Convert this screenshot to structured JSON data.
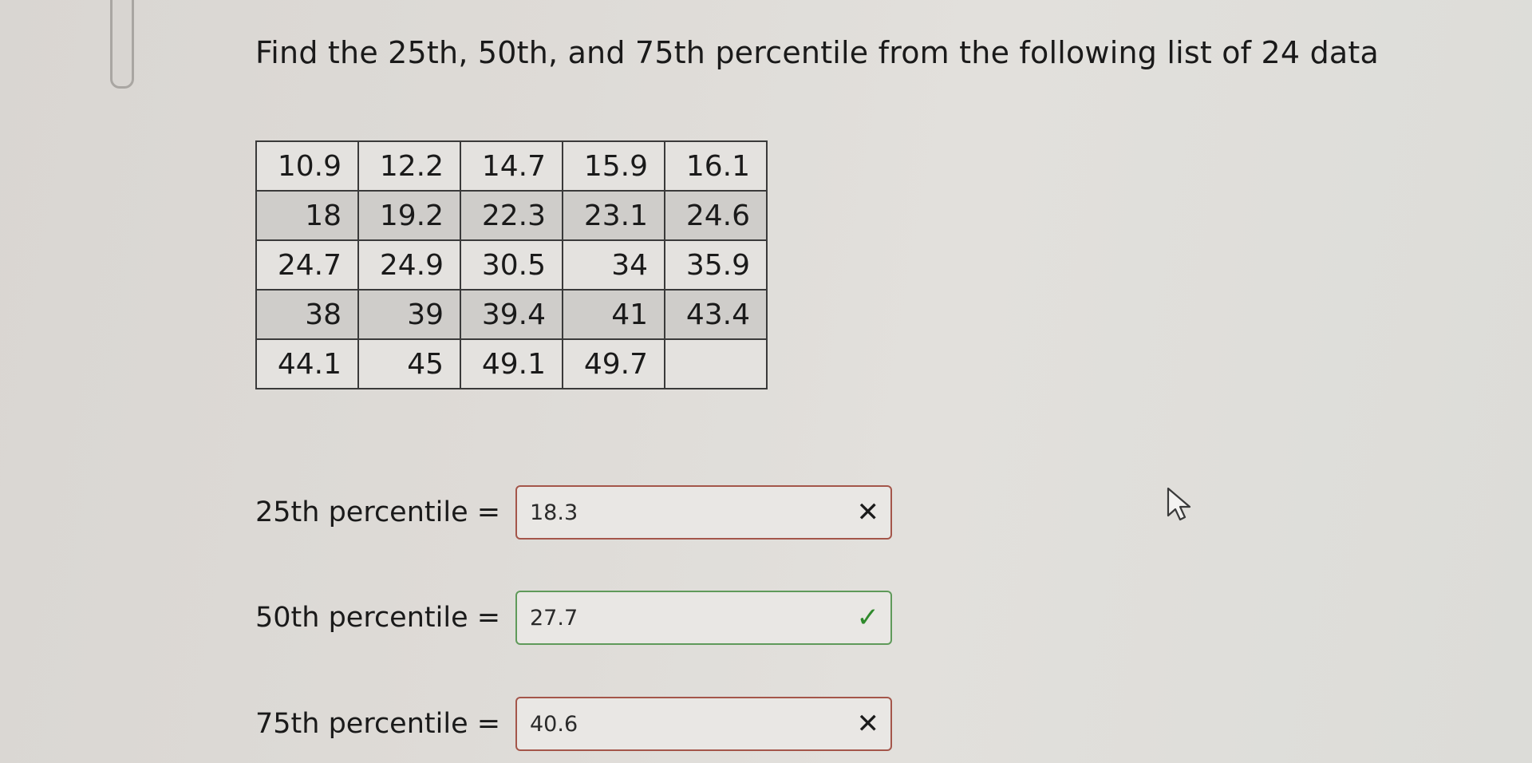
{
  "question": {
    "text": "Find the 25th, 50th, and 75th percentile from the following list of 24 data"
  },
  "data_table": {
    "rows": [
      [
        "10.9",
        "12.2",
        "14.7",
        "15.9",
        "16.1"
      ],
      [
        "18",
        "19.2",
        "22.3",
        "23.1",
        "24.6"
      ],
      [
        "24.7",
        "24.9",
        "30.5",
        "34",
        "35.9"
      ],
      [
        "38",
        "39",
        "39.4",
        "41",
        "43.4"
      ],
      [
        "44.1",
        "45",
        "49.1",
        "49.7",
        ""
      ]
    ]
  },
  "answers": {
    "p25": {
      "label": "25th percentile =",
      "value": "18.3",
      "status": "incorrect",
      "mark": "✕"
    },
    "p50": {
      "label": "50th percentile =",
      "value": "27.7",
      "status": "correct",
      "mark": "✓"
    },
    "p75": {
      "label": "75th percentile =",
      "value": "40.6",
      "status": "incorrect",
      "mark": "✕"
    }
  },
  "colors": {
    "incorrect_border": "#a4564a",
    "correct_border": "#5f9a5a",
    "check": "#2f8a2c"
  },
  "icons": {
    "cursor": "mouse-pointer-icon",
    "incorrect": "x-mark-icon",
    "correct": "check-mark-icon"
  }
}
